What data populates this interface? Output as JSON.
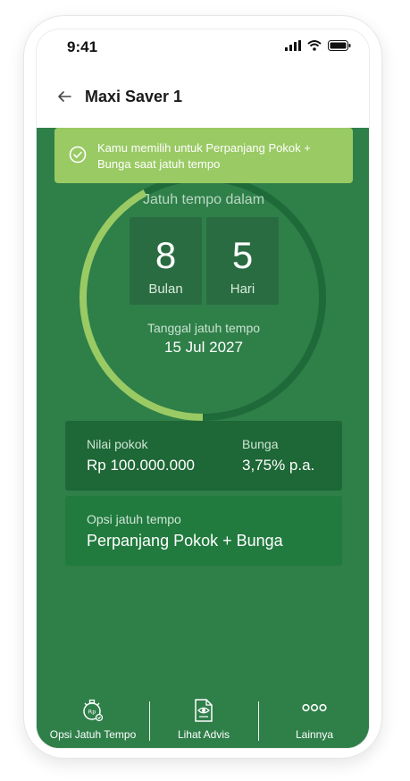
{
  "status": {
    "time": "9:41"
  },
  "header": {
    "title": "Maxi Saver 1"
  },
  "banner": {
    "text": "Kamu memilih untuk Perpanjang Pokok + Bunga saat jatuh tempo"
  },
  "maturity": {
    "label": "Jatuh tempo dalam",
    "months": "8",
    "months_unit": "Bulan",
    "days": "5",
    "days_unit": "Hari",
    "due_label": "Tanggal jatuh tempo",
    "due_date": "15 Jul 2027",
    "elapsed_fraction": 0.42
  },
  "deposit": {
    "principal_label": "Nilai pokok",
    "principal_value": "Rp 100.000.000",
    "interest_label": "Bunga",
    "interest_value": "3,75% p.a."
  },
  "option": {
    "label": "Opsi jatuh tempo",
    "value": "Perpanjang Pokok + Bunga"
  },
  "bottom_nav": [
    {
      "label": "Opsi Jatuh Tempo",
      "icon": "stopwatch-rp-icon"
    },
    {
      "label": "Lihat Advis",
      "icon": "document-eye-icon"
    },
    {
      "label": "Lainnya",
      "icon": "more-dots-icon"
    }
  ],
  "colors": {
    "background": "#2f7f49",
    "banner": "#9aca64",
    "ring_track": "#1e6b39",
    "ring_progress": "#9aca64",
    "card_dark": "#1e6736"
  }
}
